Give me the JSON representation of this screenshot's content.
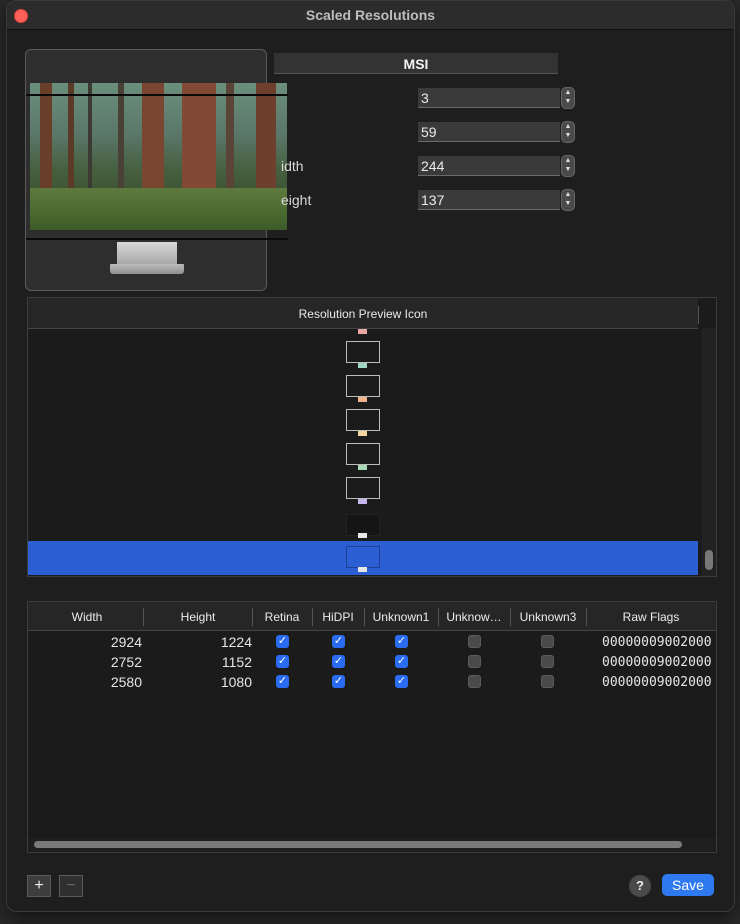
{
  "window": {
    "title": "Scaled Resolutions"
  },
  "display": {
    "name": "MSI",
    "fields": [
      {
        "label": "",
        "value": "3"
      },
      {
        "label": "",
        "value": "59"
      },
      {
        "label": "idth",
        "value": "244"
      },
      {
        "label": "eight",
        "value": "137"
      }
    ]
  },
  "icon_list": {
    "header": "Resolution Preview Icon",
    "stand_colors": [
      "#eaa8a5",
      "#9fd6c6",
      "#f1b38c",
      "#f4d6a1",
      "#a8d8b5",
      "#c6b6ee",
      "#e9e9e9",
      "#e6e6e6"
    ]
  },
  "table": {
    "headers": [
      "Width",
      "Height",
      "Retina",
      "HiDPI",
      "Unknown1",
      "Unknow…",
      "Unknown3",
      "Raw Flags"
    ],
    "rows": [
      {
        "width": "2924",
        "height": "1224",
        "retina": true,
        "hidpi": true,
        "unknown1": true,
        "unknown2": false,
        "unknown3": false,
        "raw_flags": "00000009002000"
      },
      {
        "width": "2752",
        "height": "1152",
        "retina": true,
        "hidpi": true,
        "unknown1": true,
        "unknown2": false,
        "unknown3": false,
        "raw_flags": "00000009002000"
      },
      {
        "width": "2580",
        "height": "1080",
        "retina": true,
        "hidpi": true,
        "unknown1": true,
        "unknown2": false,
        "unknown3": false,
        "raw_flags": "00000009002000"
      }
    ]
  },
  "footer": {
    "add": "+",
    "remove": "−",
    "help": "?",
    "save": "Save"
  },
  "colors": {
    "accent": "#2e78f0",
    "selection": "#2d5fd4",
    "close": "#fe5f57"
  }
}
